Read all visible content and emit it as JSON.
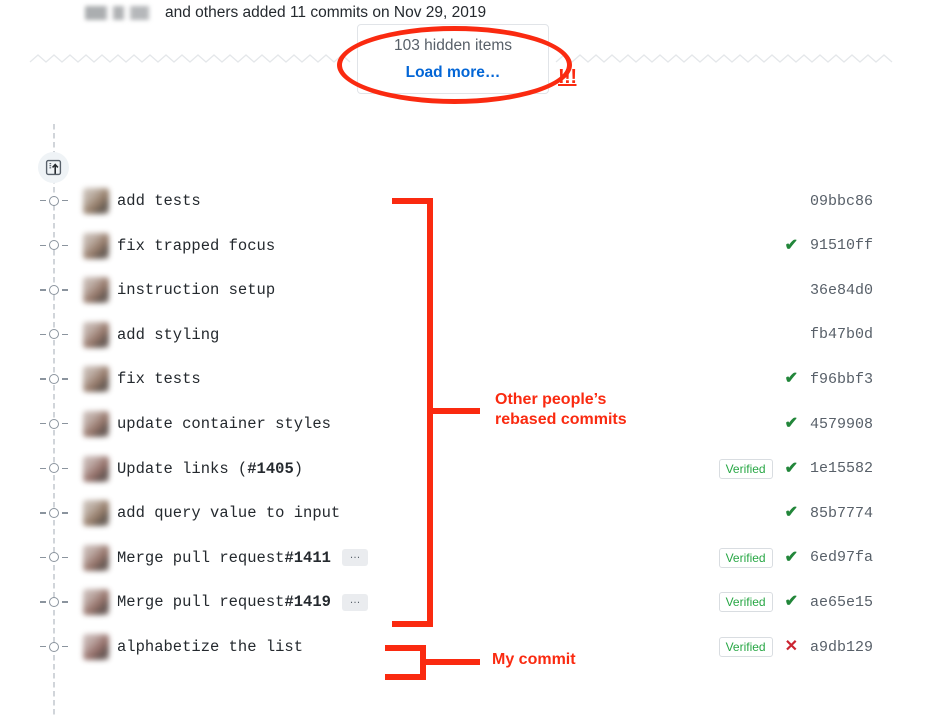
{
  "hidden_items": {
    "count_label": "103 hidden items",
    "load_more_label": "Load more…",
    "exclaim": "!!!"
  },
  "commit_group": {
    "header_text": "and others added 11 commits on Nov 29, 2019",
    "icon": "commit-push-icon"
  },
  "commits": [
    {
      "message": "add tests",
      "message_bold": "",
      "ellipsis": false,
      "verified": "",
      "status": "",
      "sha": "09bbc86",
      "avatar_hue": 28
    },
    {
      "message": "fix trapped focus",
      "message_bold": "",
      "ellipsis": false,
      "verified": "",
      "status": "check",
      "sha": "91510ff",
      "avatar_hue": 24
    },
    {
      "message": "instruction setup",
      "message_bold": "",
      "ellipsis": false,
      "verified": "",
      "status": "",
      "sha": "36e84d0",
      "avatar_hue": 20
    },
    {
      "message": "add styling",
      "message_bold": "",
      "ellipsis": false,
      "verified": "",
      "status": "",
      "sha": "fb47b0d",
      "avatar_hue": 18
    },
    {
      "message": "fix tests",
      "message_bold": "",
      "ellipsis": false,
      "verified": "",
      "status": "check",
      "sha": "f96bbf3",
      "avatar_hue": 22
    },
    {
      "message": "update container styles",
      "message_bold": "",
      "ellipsis": false,
      "verified": "",
      "status": "check",
      "sha": "4579908",
      "avatar_hue": 16
    },
    {
      "message": "Update links (",
      "message_bold": "#1405",
      "message_tail": ")",
      "ellipsis": false,
      "verified": "Verified",
      "status": "check",
      "sha": "1e15582",
      "avatar_hue": 10
    },
    {
      "message": "add query value to input",
      "message_bold": "",
      "ellipsis": false,
      "verified": "",
      "status": "check",
      "sha": "85b7774",
      "avatar_hue": 26
    },
    {
      "message": "Merge pull request ",
      "message_bold": "#1411",
      "ellipsis": true,
      "verified": "Verified",
      "status": "check",
      "sha": "6ed97fa",
      "avatar_hue": 14
    },
    {
      "message": "Merge pull request ",
      "message_bold": "#1419",
      "ellipsis": true,
      "verified": "Verified",
      "status": "check",
      "sha": "ae65e15",
      "avatar_hue": 12
    },
    {
      "message": "alphabetize the list",
      "message_bold": "",
      "ellipsis": false,
      "verified": "Verified",
      "status": "x",
      "sha": "a9db129",
      "avatar_hue": 8
    }
  ],
  "annotations": {
    "others_label": "Other people’s\nrebased commits",
    "others_line1": "Other people’s",
    "others_line2": "rebased commits",
    "my_label": "My commit"
  },
  "colors": {
    "annotation_red": "#fa2a10",
    "link_blue": "#0366d6",
    "verified_green": "#28a745",
    "check_green": "#22863a",
    "x_red": "#cb2431",
    "muted_text": "#586069",
    "primary_text": "#24292e",
    "rail_gray": "#d1d5da"
  }
}
